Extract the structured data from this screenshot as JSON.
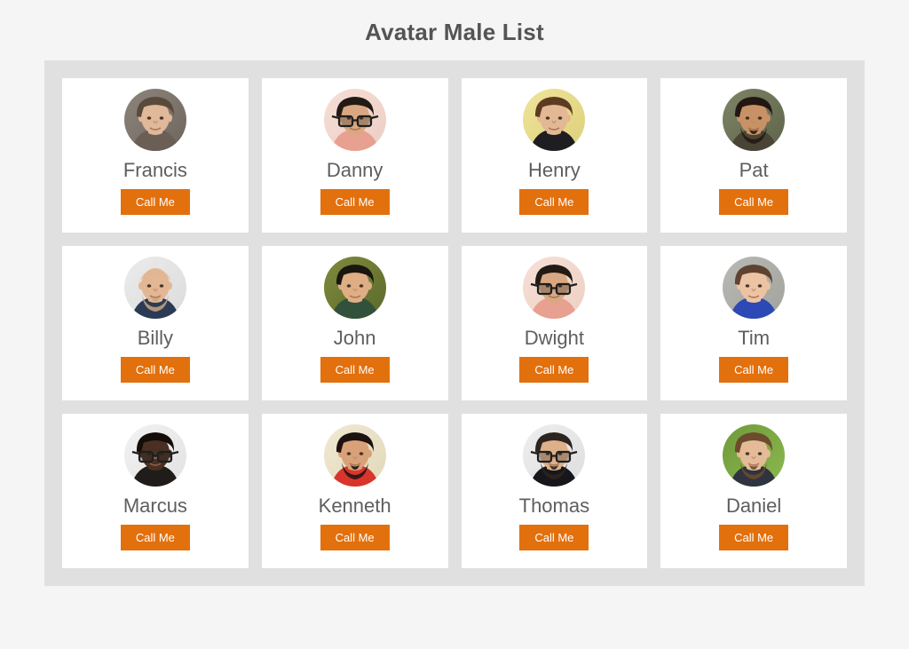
{
  "page": {
    "title": "Avatar Male List",
    "background_color": "#f5f5f5",
    "panel_color": "#e0e0e0",
    "card_color": "#ffffff",
    "title_color": "#545454",
    "name_color": "#5e5e5e",
    "button_color": "#e2700d",
    "button_text_color": "#ffffff"
  },
  "avatars": [
    {
      "name": "Francis",
      "button_label": "Call Me",
      "photo": {
        "alt": "photo-francis",
        "bg": "#8d857c",
        "bg2": "#6e655d",
        "skin": "#e0b89a",
        "hair": "#5a4a3c",
        "shirt": "#6a5e55",
        "glasses": false,
        "beard": false,
        "bald": false
      }
    },
    {
      "name": "Danny",
      "button_label": "Call Me",
      "photo": {
        "alt": "photo-danny",
        "bg": "#f6ded6",
        "bg2": "#eccfc4",
        "skin": "#d9a882",
        "hair": "#221a14",
        "shirt": "#e8a090",
        "glasses": true,
        "beard": false,
        "bald": false
      }
    },
    {
      "name": "Henry",
      "button_label": "Call Me",
      "photo": {
        "alt": "photo-henry",
        "bg": "#efe59a",
        "bg2": "#ddd07a",
        "skin": "#e3b894",
        "hair": "#5c3b22",
        "shirt": "#1d1d22",
        "glasses": false,
        "beard": false,
        "bald": false
      }
    },
    {
      "name": "Pat",
      "button_label": "Call Me",
      "photo": {
        "alt": "photo-pat",
        "bg": "#7d8466",
        "bg2": "#5e6449",
        "skin": "#c99166",
        "hair": "#221712",
        "shirt": "#4a4436",
        "glasses": false,
        "beard": true,
        "bald": false
      }
    },
    {
      "name": "Billy",
      "button_label": "Call Me",
      "photo": {
        "alt": "photo-billy",
        "bg": "#ebebeb",
        "bg2": "#dcdcdc",
        "skin": "#e3b793",
        "hair": "#c9a583",
        "shirt": "#2b3b55",
        "glasses": false,
        "beard": true,
        "bald": true
      }
    },
    {
      "name": "John",
      "button_label": "Call Me",
      "photo": {
        "alt": "photo-john",
        "bg": "#7f8a3c",
        "bg2": "#5b6a2c",
        "skin": "#dfae84",
        "hair": "#1a1510",
        "shirt": "#31513a",
        "glasses": false,
        "beard": false,
        "bald": false
      }
    },
    {
      "name": "Dwight",
      "button_label": "Call Me",
      "photo": {
        "alt": "photo-dwight",
        "bg": "#f7e0d6",
        "bg2": "#edd0c3",
        "skin": "#d9a882",
        "hair": "#221a14",
        "shirt": "#e8a090",
        "glasses": true,
        "beard": false,
        "bald": false
      }
    },
    {
      "name": "Tim",
      "button_label": "Call Me",
      "photo": {
        "alt": "photo-tim",
        "bg": "#b9b9b5",
        "bg2": "#a3a39d",
        "skin": "#ecc3a3",
        "hair": "#5f4330",
        "shirt": "#2c49b5",
        "glasses": false,
        "beard": false,
        "bald": false
      }
    },
    {
      "name": "Marcus",
      "button_label": "Call Me",
      "photo": {
        "alt": "photo-marcus",
        "bg": "#f2f2f2",
        "bg2": "#e2e2e2",
        "skin": "#4a3022",
        "hair": "#140d08",
        "shirt": "#201c1a",
        "glasses": true,
        "beard": false,
        "bald": false
      }
    },
    {
      "name": "Kenneth",
      "button_label": "Call Me",
      "photo": {
        "alt": "photo-kenneth",
        "bg": "#f0e9d2",
        "bg2": "#e2d9bb",
        "skin": "#d9a178",
        "hair": "#1c1310",
        "shirt": "#d8352c",
        "glasses": false,
        "beard": true,
        "bald": false
      }
    },
    {
      "name": "Thomas",
      "button_label": "Call Me",
      "photo": {
        "alt": "photo-thomas",
        "bg": "#eeeeee",
        "bg2": "#dedede",
        "skin": "#ddb08a",
        "hair": "#2d2420",
        "shirt": "#17161a",
        "glasses": true,
        "beard": true,
        "bald": false
      }
    },
    {
      "name": "Daniel",
      "button_label": "Call Me",
      "photo": {
        "alt": "photo-daniel",
        "bg": "#6f9a3c",
        "bg2": "#8cb84e",
        "skin": "#e5bb97",
        "hair": "#6d4b2e",
        "shirt": "#2e3440",
        "glasses": false,
        "beard": true,
        "bald": false
      }
    }
  ]
}
